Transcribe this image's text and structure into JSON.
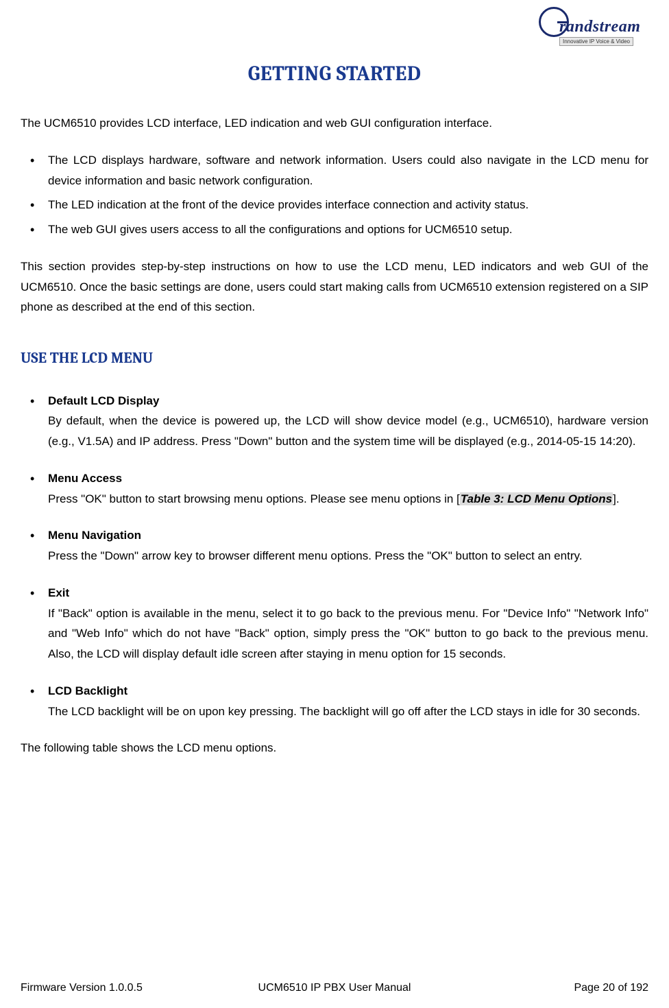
{
  "logo": {
    "brand": "randstream",
    "tagline": "Innovative IP Voice & Video"
  },
  "title": "GETTING STARTED",
  "intro": "The UCM6510 provides LCD interface, LED indication and web GUI configuration interface.",
  "intro_bullets": [
    "The LCD displays hardware, software and network information. Users could also navigate in the LCD menu for device information and basic network configuration.",
    "The LED indication at the front of the device provides interface connection and activity status.",
    "The web GUI gives users access to all the configurations and options for UCM6510 setup."
  ],
  "intro_followup": "This section provides step-by-step instructions on how to use the LCD menu, LED indicators and web GUI of the UCM6510. Once the basic settings are done, users could start making calls from UCM6510 extension registered on a SIP phone as described at the end of this section.",
  "section_heading": "USE THE LCD MENU",
  "topics": [
    {
      "title": "Default LCD Display",
      "body": "By default, when the device is powered up, the LCD will show device model (e.g., UCM6510), hardware version (e.g., V1.5A) and IP address. Press \"Down\" button and the system time will be displayed (e.g., 2014-05-15 14:20)."
    },
    {
      "title": "Menu Access",
      "body_pre": "Press \"OK\" button to start browsing menu options. Please see menu options in [",
      "ref": "Table 3: LCD Menu Options",
      "body_post": "]."
    },
    {
      "title": "Menu Navigation",
      "body": "Press the \"Down\" arrow key to browser different menu options. Press the \"OK\" button to select an entry."
    },
    {
      "title": "Exit",
      "body": "If \"Back\" option is available in the menu, select it to go back to the previous menu. For \"Device Info\" \"Network Info\" and \"Web Info\" which do not have \"Back\" option, simply press the \"OK\" button to go back to the previous menu. Also, the LCD will display default idle screen after staying in menu option for 15 seconds."
    },
    {
      "title": "LCD Backlight",
      "body": "The LCD backlight will be on upon key pressing. The backlight will go off after the LCD stays in idle for 30 seconds."
    }
  ],
  "trailing": "The following table shows the LCD menu options.",
  "footer": {
    "left": "Firmware Version 1.0.0.5",
    "center": "UCM6510 IP PBX User Manual",
    "right": "Page 20 of 192"
  }
}
